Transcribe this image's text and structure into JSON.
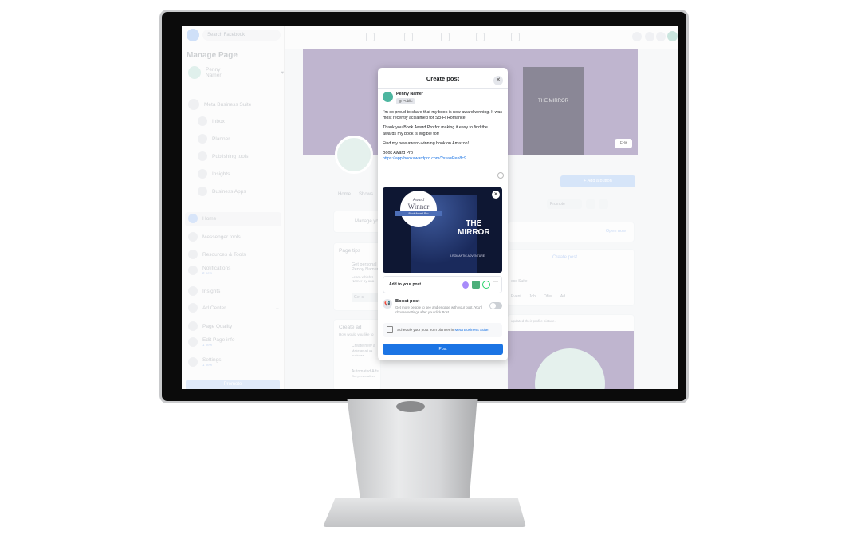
{
  "topbar": {
    "search_placeholder": "Search Facebook"
  },
  "sidebar": {
    "title": "Manage Page",
    "page_name": "Penny Namer",
    "suite_label": "Meta Business Suite",
    "suite_items": [
      "Inbox",
      "Planner",
      "Publishing tools",
      "Insights",
      "Business Apps"
    ],
    "items": [
      {
        "label": "Home",
        "sub": ""
      },
      {
        "label": "Messenger tools",
        "sub": ""
      },
      {
        "label": "Resources & Tools",
        "sub": ""
      },
      {
        "label": "Notifications",
        "sub": "2 new"
      },
      {
        "label": "Insights",
        "sub": ""
      },
      {
        "label": "Ad Center",
        "sub": ""
      },
      {
        "label": "Page Quality",
        "sub": ""
      },
      {
        "label": "Edit Page info",
        "sub": "1 new"
      },
      {
        "label": "Settings",
        "sub": "1 new"
      }
    ],
    "promote_label": "Promote"
  },
  "page": {
    "cover_book_title": "THE MIRROR",
    "edit_label": "Edit",
    "add_button_label": "+ Add a button",
    "tabs": [
      "Home",
      "Shows"
    ],
    "promote_label": "Promote",
    "manage_label": "Manage your",
    "open_now_label": "Open now",
    "create_post_label": "Create post",
    "suite_text": "ess Suite",
    "post_types": [
      "Event",
      "Job",
      "Offer",
      "Ad"
    ],
    "updated_text": "updated their profile picture.",
    "page_tips_title": "Page tips",
    "tip_title": "Get personal Penny Namer",
    "tip_text": "Learn which t Namer by ana",
    "tip_button": "Get s",
    "create_ad_title": "Create ad",
    "create_ad_sub": "How would you like to",
    "ad_options": [
      {
        "title": "Create new a",
        "text": "Make an ad us business"
      },
      {
        "title": "Automated Ads",
        "text": "Get personalized"
      }
    ]
  },
  "modal": {
    "title": "Create post",
    "author": "Penny Namer",
    "audience": "Public",
    "paragraphs": [
      "I'm so proud to share that my book is now award winning. It was most recently acclaimed for Sci-Fi Romance.",
      "Thank you Book Award Pro for making it easy to find the awards my book is eligible for!",
      "Find my new award-winning book on Amazon!"
    ],
    "signature": "Book Award Pro",
    "link": "https://app.bookawardpro.com/?ssa=Pen8c9",
    "image": {
      "badge_top": "Award",
      "badge_main": "Winner",
      "badge_ribbon": "Book Award Pro",
      "book_title_1": "THE",
      "book_title_2": "MIRROR",
      "book_sub": "A ROMANTIC ADVENTURE"
    },
    "add_to_post": "Add to your post",
    "boost_title": "Boost post",
    "boost_text": "Get more people to see and engage with your post. You'll choose settings after you click Post.",
    "boost_enabled": false,
    "schedule_text": "Schedule your post from planner in ",
    "schedule_link": "Meta Business Suite.",
    "post_button": "Post",
    "accent": "#1b74e4"
  }
}
